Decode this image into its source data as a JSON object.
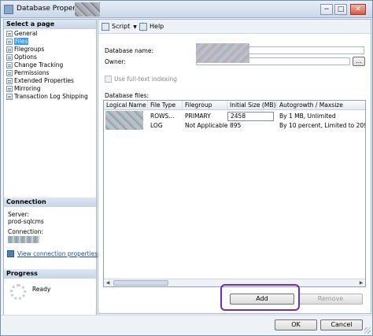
{
  "window": {
    "title": "Database Properties - ",
    "minimize": "−",
    "maximize": "□",
    "close": "✕"
  },
  "left": {
    "select_page_header": "Select a page",
    "pages": [
      {
        "label": "General",
        "icon": "page-icon",
        "selected": false
      },
      {
        "label": "Files",
        "icon": "page-icon",
        "selected": true
      },
      {
        "label": "Filegroups",
        "icon": "page-icon",
        "selected": false
      },
      {
        "label": "Options",
        "icon": "page-icon",
        "selected": false
      },
      {
        "label": "Change Tracking",
        "icon": "page-icon",
        "selected": false
      },
      {
        "label": "Permissions",
        "icon": "page-icon",
        "selected": false
      },
      {
        "label": "Extended Properties",
        "icon": "page-icon",
        "selected": false
      },
      {
        "label": "Mirroring",
        "icon": "page-icon",
        "selected": false
      },
      {
        "label": "Transaction Log Shipping",
        "icon": "page-icon",
        "selected": false
      }
    ],
    "connection_header": "Connection",
    "server_label": "Server:",
    "server_value": "prod-sqlcms",
    "connection_label": "Connection:",
    "view_connection_link": "View connection properties",
    "progress_header": "Progress",
    "progress_status": "Ready"
  },
  "toolbar": {
    "script_label": "Script",
    "help_label": "Help"
  },
  "form": {
    "database_name_label": "Database name:",
    "owner_label": "Owner:",
    "owner_value": "",
    "owner_browse": "...",
    "fulltext_label": "Use full-text indexing",
    "database_files_label": "Database files:"
  },
  "grid": {
    "columns": [
      "Logical Name",
      "File Type",
      "Filegroup",
      "Initial Size (MB)",
      "Autogrowth / Maxsize"
    ],
    "rows": [
      {
        "logical_name": "",
        "file_type": "ROWS...",
        "filegroup": "PRIMARY",
        "initial_size": "2458",
        "autogrowth": "By 1 MB, Unlimited"
      },
      {
        "logical_name": "",
        "file_type": "LOG",
        "filegroup": "Not Applicable",
        "initial_size": "895",
        "autogrowth": "By 10 percent, Limited to 209..."
      }
    ]
  },
  "buttons": {
    "add": "Add",
    "remove": "Remove",
    "ok": "OK",
    "cancel": "Cancel"
  },
  "colors": {
    "selection": "#3399ff",
    "highlight_ring": "#6a2fc4",
    "link": "#1c4fa8"
  }
}
